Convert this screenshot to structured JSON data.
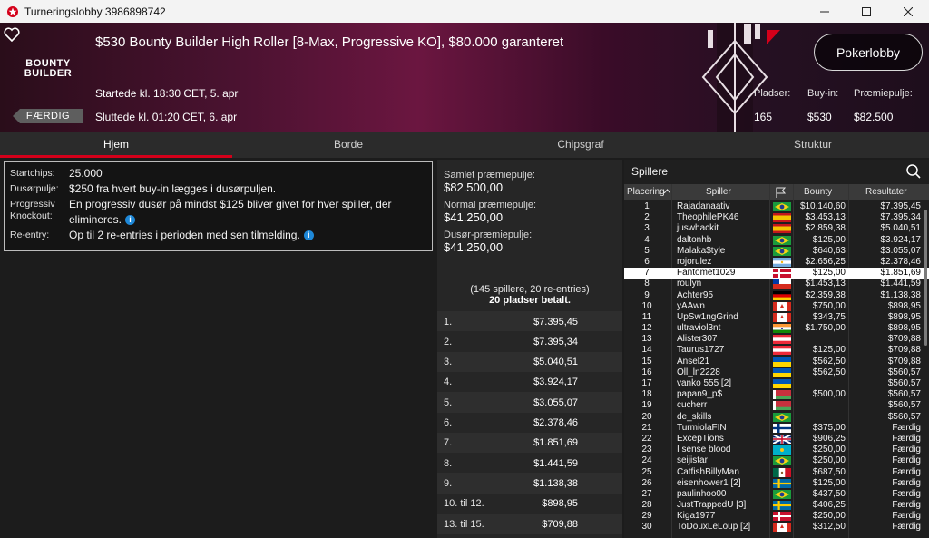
{
  "window": {
    "title": "Turneringslobby 3986898742"
  },
  "header": {
    "tournament_name": "$530 Bounty Builder High Roller [8-Max, Progressive KO], $80.000 garanteret",
    "logo_line1": "BOUNTY",
    "logo_line2": "BUILDER",
    "started": "Startede kl. 18:30 CET, 5. apr",
    "ended": "Sluttede kl. 01:20 CET, 6. apr",
    "status": "FÆRDIG",
    "lobby_button": "Pokerlobby",
    "stats": {
      "seats_label": "Pladser:",
      "seats": "165",
      "buyin_label": "Buy-in:",
      "buyin": "$530",
      "prize_label": "Præmiepulje:",
      "prize": "$82.500"
    }
  },
  "tabs": [
    "Hjem",
    "Borde",
    "Chipsgraf",
    "Struktur"
  ],
  "info": {
    "rows": [
      {
        "k": "Startchips:",
        "v": "25.000"
      },
      {
        "k": "Dusørpulje:",
        "v": "$250 fra hvert buy-in lægges i dusørpuljen."
      },
      {
        "k": "Progressiv Knockout:",
        "v": "En progressiv dusør på mindst $125 bliver givet for hver spiller, der elimineres."
      },
      {
        "k": "Re-entry:",
        "v": "Op til 2 re-entries i perioden med sen tilmelding."
      }
    ]
  },
  "prize_panel": {
    "total_label": "Samlet præmiepulje:",
    "total": "$82.500,00",
    "normal_label": "Normal præmiepulje:",
    "normal": "$41.250,00",
    "bounty_label": "Dusør-præmiepulje:",
    "bounty": "$41.250,00",
    "paid_line1": "(145 spillere, 20 re-entries)",
    "paid_line2": "20 pladser betalt.",
    "payouts": [
      {
        "place": "1.",
        "amount": "$7.395,45"
      },
      {
        "place": "2.",
        "amount": "$7.395,34"
      },
      {
        "place": "3.",
        "amount": "$5.040,51"
      },
      {
        "place": "4.",
        "amount": "$3.924,17"
      },
      {
        "place": "5.",
        "amount": "$3.055,07"
      },
      {
        "place": "6.",
        "amount": "$2.378,46"
      },
      {
        "place": "7.",
        "amount": "$1.851,69"
      },
      {
        "place": "8.",
        "amount": "$1.441,59"
      },
      {
        "place": "9.",
        "amount": "$1.138,38"
      },
      {
        "place": "10. til 12.",
        "amount": "$898,95"
      },
      {
        "place": "13. til 15.",
        "amount": "$709,88"
      }
    ]
  },
  "players_panel": {
    "title": "Spillere",
    "headers": {
      "place": "Placering",
      "player": "Spiller",
      "bounty": "Bounty",
      "result": "Resultater"
    },
    "highlighted_row": 7,
    "rows": [
      {
        "place": "1",
        "name": "Rajadanaativ",
        "flag": "brazil",
        "bounty": "$10.140,60",
        "result": "$7.395,45"
      },
      {
        "place": "2",
        "name": "TheophilePK46",
        "flag": "spain",
        "bounty": "$3.453,13",
        "result": "$7.395,34"
      },
      {
        "place": "3",
        "name": "juswhackit",
        "flag": "spain",
        "bounty": "$2.859,38",
        "result": "$5.040,51"
      },
      {
        "place": "4",
        "name": "daltonhb",
        "flag": "brazil",
        "bounty": "$125,00",
        "result": "$3.924,17"
      },
      {
        "place": "5",
        "name": "Malaka$tyle",
        "flag": "brazil",
        "bounty": "$640,63",
        "result": "$3.055,07"
      },
      {
        "place": "6",
        "name": "rojorulez",
        "flag": "argentina",
        "bounty": "$2.656,25",
        "result": "$2.378,46"
      },
      {
        "place": "7",
        "name": "Fantomet1029",
        "flag": "denmark",
        "bounty": "$125,00",
        "result": "$1.851,69"
      },
      {
        "place": "8",
        "name": "roulyn",
        "flag": "chile",
        "bounty": "$1.453,13",
        "result": "$1.441,59"
      },
      {
        "place": "9",
        "name": "Achter95",
        "flag": "germany",
        "bounty": "$2.359,38",
        "result": "$1.138,38"
      },
      {
        "place": "10",
        "name": "yAAwn",
        "flag": "canada",
        "bounty": "$750,00",
        "result": "$898,95"
      },
      {
        "place": "11",
        "name": "UpSw1ngGrind",
        "flag": "canada",
        "bounty": "$343,75",
        "result": "$898,95"
      },
      {
        "place": "12",
        "name": "ultraviol3nt",
        "flag": "india",
        "bounty": "$1.750,00",
        "result": "$898,95"
      },
      {
        "place": "13",
        "name": "Alister307",
        "flag": "austria",
        "bounty": "",
        "result": "$709,88"
      },
      {
        "place": "14",
        "name": "Taurus1727",
        "flag": "austria",
        "bounty": "$125,00",
        "result": "$709,88"
      },
      {
        "place": "15",
        "name": "Ansel21",
        "flag": "ukraine",
        "bounty": "$562,50",
        "result": "$709,88"
      },
      {
        "place": "16",
        "name": "Oll_ln2228",
        "flag": "ukraine",
        "bounty": "$562,50",
        "result": "$560,57"
      },
      {
        "place": "17",
        "name": "vanko 555 [2]",
        "flag": "ukraine",
        "bounty": "",
        "result": "$560,57"
      },
      {
        "place": "18",
        "name": "papan9_p$",
        "flag": "belarus",
        "bounty": "$500,00",
        "result": "$560,57"
      },
      {
        "place": "19",
        "name": "cucherr",
        "flag": "belarus",
        "bounty": "",
        "result": "$560,57"
      },
      {
        "place": "20",
        "name": "de_skills",
        "flag": "brazil",
        "bounty": "",
        "result": "$560,57"
      },
      {
        "place": "21",
        "name": "TurmiolaFIN",
        "flag": "finland",
        "bounty": "$375,00",
        "result": "Færdig"
      },
      {
        "place": "22",
        "name": "ExcepTions",
        "flag": "uk",
        "bounty": "$906,25",
        "result": "Færdig"
      },
      {
        "place": "23",
        "name": "I sense blood",
        "flag": "kazakhstan",
        "bounty": "$250,00",
        "result": "Færdig"
      },
      {
        "place": "24",
        "name": "seijistar",
        "flag": "brazil",
        "bounty": "$250,00",
        "result": "Færdig"
      },
      {
        "place": "25",
        "name": "CatfishBillyMan",
        "flag": "mexico",
        "bounty": "$687,50",
        "result": "Færdig"
      },
      {
        "place": "26",
        "name": "eisenhower1 [2]",
        "flag": "sweden",
        "bounty": "$125,00",
        "result": "Færdig"
      },
      {
        "place": "27",
        "name": "paulinhoo00",
        "flag": "brazil",
        "bounty": "$437,50",
        "result": "Færdig"
      },
      {
        "place": "28",
        "name": "JustTrappedU [3]",
        "flag": "sweden",
        "bounty": "$406,25",
        "result": "Færdig"
      },
      {
        "place": "29",
        "name": "Kiga1977",
        "flag": "denmark",
        "bounty": "$250,00",
        "result": "Færdig"
      },
      {
        "place": "30",
        "name": "ToDouxLeLoup [2]",
        "flag": "canada",
        "bounty": "$312,50",
        "result": "Færdig"
      }
    ]
  },
  "colors": {
    "accent": "#d4001a",
    "info": "#1e88d8"
  }
}
